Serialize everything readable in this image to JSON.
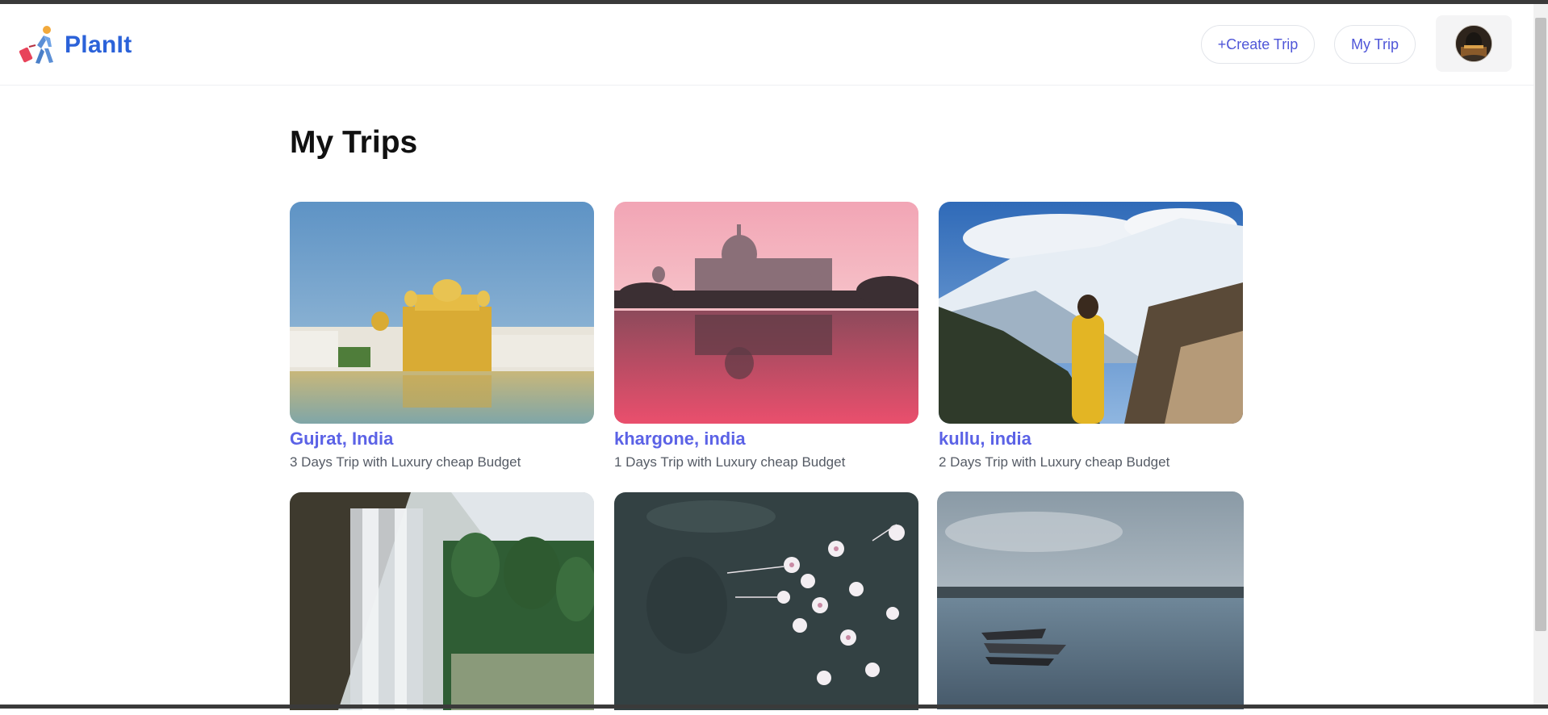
{
  "app": {
    "name": "PlanIt",
    "logo_icon": "traveler-with-suitcase-icon"
  },
  "header": {
    "create_trip_label": "+Create Trip",
    "my_trip_label": "My Trip",
    "avatar_icon": "user-avatar"
  },
  "page": {
    "title": "My Trips"
  },
  "trips": [
    {
      "title": "Gujrat, India",
      "subtitle": "3 Days Trip with Luxury cheap Budget"
    },
    {
      "title": "khargone, india",
      "subtitle": "1 Days Trip with Luxury cheap Budget"
    },
    {
      "title": "kullu, india",
      "subtitle": "2 Days Trip with Luxury cheap Budget"
    },
    {
      "title": "",
      "subtitle": ""
    },
    {
      "title": "",
      "subtitle": ""
    },
    {
      "title": "",
      "subtitle": ""
    }
  ],
  "colors": {
    "brand": "#2b62d9",
    "accent": "#5b62e6",
    "button_text": "#4f56d8"
  }
}
